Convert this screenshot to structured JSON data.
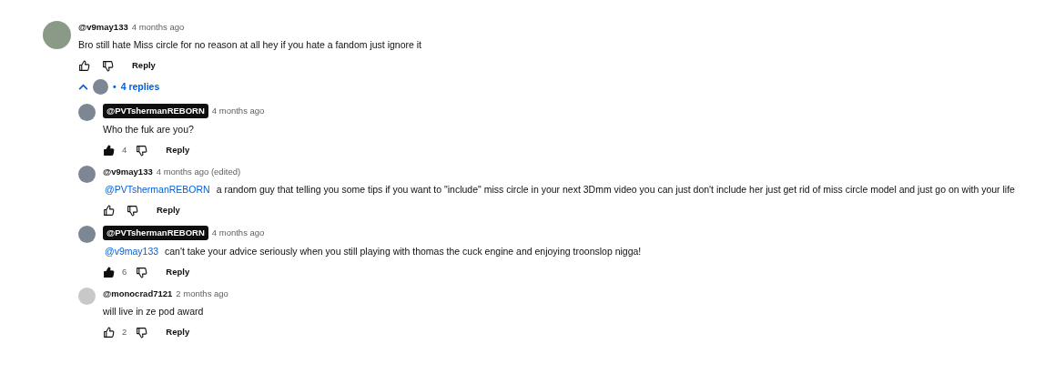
{
  "comment": {
    "author": "@v9may133",
    "author_highlighted": false,
    "time": "4 months ago",
    "text": "Bro still hate Miss circle for no reason at all hey if you hate a fandom just ignore it",
    "liked": false,
    "reply_label": "Reply"
  },
  "replies_toggle": {
    "expanded": true,
    "separator": "•",
    "label": "4 replies"
  },
  "replies": [
    {
      "author": "@PVTshermanREBORN",
      "author_highlighted": true,
      "time": "4 months ago",
      "text": "Who the fuk are you?",
      "likes": "4",
      "liked": true,
      "reply_label": "Reply"
    },
    {
      "author": "@v9may133",
      "author_highlighted": false,
      "time": "4 months ago (edited)",
      "mention": "@PVTshermanREBORN",
      "text": "a random guy that telling you some tips if you  want to \"include\" miss circle in your next 3Dmm video you can just don't include her just get rid of miss circle model and just go on with your life",
      "liked": false,
      "reply_label": "Reply"
    },
    {
      "author": "@PVTshermanREBORN",
      "author_highlighted": true,
      "time": "4 months ago",
      "mention": "@v9may133",
      "text": "can't take your advice seriously when you still playing with thomas the cuck engine and enjoying troonslop nigga!",
      "likes": "6",
      "liked": true,
      "reply_label": "Reply"
    },
    {
      "author": "@monocrad7121",
      "author_highlighted": false,
      "time": "2 months ago",
      "text": "will live in ze pod award",
      "likes": "2",
      "liked": false,
      "reply_label": "Reply"
    }
  ]
}
